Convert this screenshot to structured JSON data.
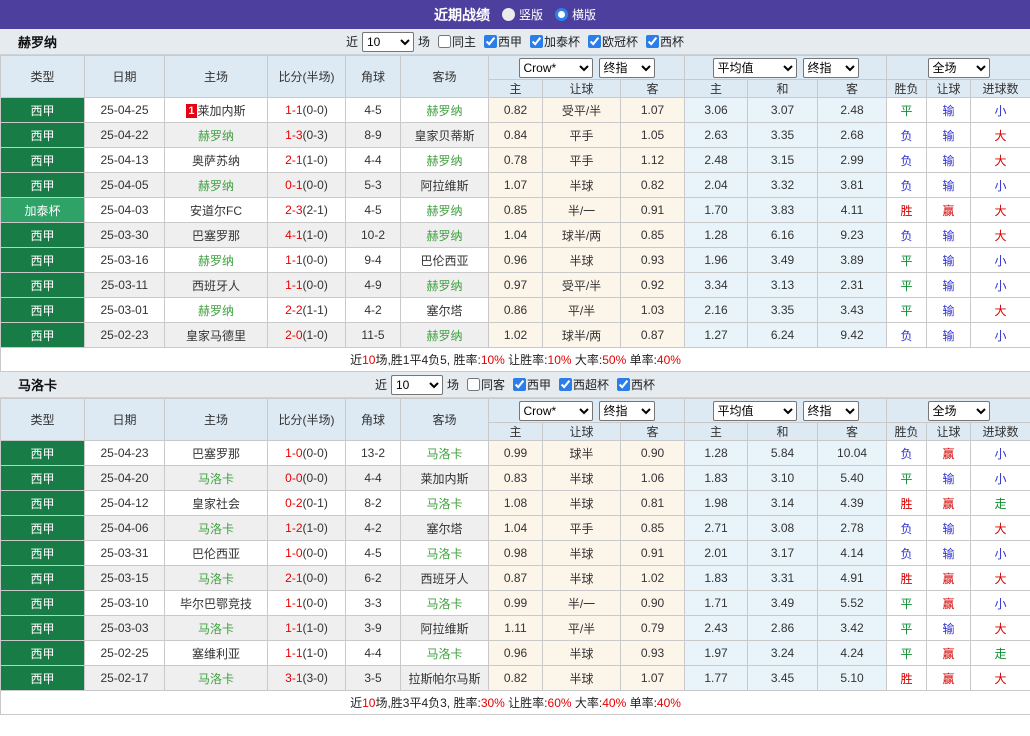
{
  "titlebar": {
    "title": "近期战绩",
    "options": [
      {
        "label": "竖版",
        "selected": true
      },
      {
        "label": "横版",
        "selected": false
      }
    ]
  },
  "columns": {
    "type": "类型",
    "date": "日期",
    "home": "主场",
    "score": "比分(半场)",
    "corner": "角球",
    "away": "客场",
    "crow": "Crow*",
    "final": "终指",
    "avg": "平均值",
    "full": "全场",
    "odds_home": "主",
    "odds_handicap": "让球",
    "odds_away": "客",
    "avg_home": "主",
    "avg_draw": "和",
    "avg_away": "客",
    "result_wdl": "胜负",
    "result_handicap": "让球",
    "result_goals": "进球数"
  },
  "accent_colors": {
    "league_green": "#187c46",
    "cup_green": "#2fa268",
    "team_green": "#3fa13f",
    "score_red": "#e60000",
    "win_red": "#d50000",
    "lose_blue": "#3030d0",
    "draw_green": "#0d8f2f",
    "titlebar_purple": "#4c3f9d"
  },
  "sections": [
    {
      "team": "赫罗纳",
      "filter": {
        "prefix": "近",
        "count": "10",
        "suffix": "场",
        "same_label": "同主",
        "same_checked": false,
        "leagues": [
          {
            "label": "西甲",
            "checked": true
          },
          {
            "label": "加泰杯",
            "checked": true
          },
          {
            "label": "欧冠杯",
            "checked": true
          },
          {
            "label": "西杯",
            "checked": true
          }
        ]
      },
      "rows": [
        {
          "type": "西甲",
          "cup": false,
          "date": "25-04-25",
          "home": "莱加内斯",
          "home_badge": "1",
          "home_green": false,
          "score": "1-1",
          "half": "(0-0)",
          "corner": "4-5",
          "away": "赫罗纳",
          "away_green": true,
          "odds": [
            "0.82",
            "受平/半",
            "1.07"
          ],
          "avg": [
            "3.06",
            "3.07",
            "2.48"
          ],
          "results": [
            "平",
            "输",
            "小"
          ]
        },
        {
          "type": "西甲",
          "cup": false,
          "date": "25-04-22",
          "home": "赫罗纳",
          "home_green": true,
          "score": "1-3",
          "half": "(0-3)",
          "corner": "8-9",
          "away": "皇家贝蒂斯",
          "away_green": false,
          "odds": [
            "0.84",
            "平手",
            "1.05"
          ],
          "avg": [
            "2.63",
            "3.35",
            "2.68"
          ],
          "results": [
            "负",
            "输",
            "大"
          ]
        },
        {
          "type": "西甲",
          "cup": false,
          "date": "25-04-13",
          "home": "奥萨苏纳",
          "home_green": false,
          "score": "2-1",
          "half": "(1-0)",
          "corner": "4-4",
          "away": "赫罗纳",
          "away_green": true,
          "odds": [
            "0.78",
            "平手",
            "1.12"
          ],
          "avg": [
            "2.48",
            "3.15",
            "2.99"
          ],
          "results": [
            "负",
            "输",
            "大"
          ]
        },
        {
          "type": "西甲",
          "cup": false,
          "date": "25-04-05",
          "home": "赫罗纳",
          "home_green": true,
          "score": "0-1",
          "half": "(0-0)",
          "corner": "5-3",
          "away": "阿拉维斯",
          "away_green": false,
          "odds": [
            "1.07",
            "半球",
            "0.82"
          ],
          "avg": [
            "2.04",
            "3.32",
            "3.81"
          ],
          "results": [
            "负",
            "输",
            "小"
          ]
        },
        {
          "type": "加泰杯",
          "cup": true,
          "date": "25-04-03",
          "home": "安道尔FC",
          "home_green": false,
          "score": "2-3",
          "half": "(2-1)",
          "corner": "4-5",
          "away": "赫罗纳",
          "away_green": true,
          "odds": [
            "0.85",
            "半/一",
            "0.91"
          ],
          "avg": [
            "1.70",
            "3.83",
            "4.11"
          ],
          "results": [
            "胜",
            "赢",
            "大"
          ]
        },
        {
          "type": "西甲",
          "cup": false,
          "date": "25-03-30",
          "home": "巴塞罗那",
          "home_green": false,
          "score": "4-1",
          "half": "(1-0)",
          "corner": "10-2",
          "away": "赫罗纳",
          "away_green": true,
          "odds": [
            "1.04",
            "球半/两",
            "0.85"
          ],
          "avg": [
            "1.28",
            "6.16",
            "9.23"
          ],
          "results": [
            "负",
            "输",
            "大"
          ]
        },
        {
          "type": "西甲",
          "cup": false,
          "date": "25-03-16",
          "home": "赫罗纳",
          "home_green": true,
          "score": "1-1",
          "half": "(0-0)",
          "corner": "9-4",
          "away": "巴伦西亚",
          "away_green": false,
          "odds": [
            "0.96",
            "半球",
            "0.93"
          ],
          "avg": [
            "1.96",
            "3.49",
            "3.89"
          ],
          "results": [
            "平",
            "输",
            "小"
          ]
        },
        {
          "type": "西甲",
          "cup": false,
          "date": "25-03-11",
          "home": "西班牙人",
          "home_green": false,
          "score": "1-1",
          "half": "(0-0)",
          "corner": "4-9",
          "away": "赫罗纳",
          "away_green": true,
          "odds": [
            "0.97",
            "受平/半",
            "0.92"
          ],
          "avg": [
            "3.34",
            "3.13",
            "2.31"
          ],
          "results": [
            "平",
            "输",
            "小"
          ]
        },
        {
          "type": "西甲",
          "cup": false,
          "date": "25-03-01",
          "home": "赫罗纳",
          "home_green": true,
          "score": "2-2",
          "half": "(1-1)",
          "corner": "4-2",
          "away": "塞尔塔",
          "away_green": false,
          "odds": [
            "0.86",
            "平/半",
            "1.03"
          ],
          "avg": [
            "2.16",
            "3.35",
            "3.43"
          ],
          "results": [
            "平",
            "输",
            "大"
          ]
        },
        {
          "type": "西甲",
          "cup": false,
          "date": "25-02-23",
          "home": "皇家马德里",
          "home_green": false,
          "score": "2-0",
          "half": "(1-0)",
          "corner": "11-5",
          "away": "赫罗纳",
          "away_green": true,
          "odds": [
            "1.02",
            "球半/两",
            "0.87"
          ],
          "avg": [
            "1.27",
            "6.24",
            "9.42"
          ],
          "results": [
            "负",
            "输",
            "小"
          ]
        }
      ],
      "summary": [
        {
          "t": "近"
        },
        {
          "t": "10",
          "red": true
        },
        {
          "t": "场,胜1平4负5, 胜率:"
        },
        {
          "t": "10%",
          "red": true
        },
        {
          "t": " 让胜率:"
        },
        {
          "t": "10%",
          "red": true
        },
        {
          "t": " 大率:"
        },
        {
          "t": "50%",
          "red": true
        },
        {
          "t": " 单率:"
        },
        {
          "t": "40%",
          "red": true
        }
      ]
    },
    {
      "team": "马洛卡",
      "filter": {
        "prefix": "近",
        "count": "10",
        "suffix": "场",
        "same_label": "同客",
        "same_checked": false,
        "leagues": [
          {
            "label": "西甲",
            "checked": true
          },
          {
            "label": "西超杯",
            "checked": true
          },
          {
            "label": "西杯",
            "checked": true
          }
        ]
      },
      "rows": [
        {
          "type": "西甲",
          "cup": false,
          "date": "25-04-23",
          "home": "巴塞罗那",
          "home_green": false,
          "score": "1-0",
          "half": "(0-0)",
          "corner": "13-2",
          "away": "马洛卡",
          "away_green": true,
          "odds": [
            "0.99",
            "球半",
            "0.90"
          ],
          "avg": [
            "1.28",
            "5.84",
            "10.04"
          ],
          "results": [
            "负",
            "赢",
            "小"
          ]
        },
        {
          "type": "西甲",
          "cup": false,
          "date": "25-04-20",
          "home": "马洛卡",
          "home_green": true,
          "score": "0-0",
          "half": "(0-0)",
          "corner": "4-4",
          "away": "莱加内斯",
          "away_green": false,
          "odds": [
            "0.83",
            "半球",
            "1.06"
          ],
          "avg": [
            "1.83",
            "3.10",
            "5.40"
          ],
          "results": [
            "平",
            "输",
            "小"
          ]
        },
        {
          "type": "西甲",
          "cup": false,
          "date": "25-04-12",
          "home": "皇家社会",
          "home_green": false,
          "score": "0-2",
          "half": "(0-1)",
          "corner": "8-2",
          "away": "马洛卡",
          "away_green": true,
          "odds": [
            "1.08",
            "半球",
            "0.81"
          ],
          "avg": [
            "1.98",
            "3.14",
            "4.39"
          ],
          "results": [
            "胜",
            "赢",
            "走"
          ]
        },
        {
          "type": "西甲",
          "cup": false,
          "date": "25-04-06",
          "home": "马洛卡",
          "home_green": true,
          "score": "1-2",
          "half": "(1-0)",
          "corner": "4-2",
          "away": "塞尔塔",
          "away_green": false,
          "odds": [
            "1.04",
            "平手",
            "0.85"
          ],
          "avg": [
            "2.71",
            "3.08",
            "2.78"
          ],
          "results": [
            "负",
            "输",
            "大"
          ]
        },
        {
          "type": "西甲",
          "cup": false,
          "date": "25-03-31",
          "home": "巴伦西亚",
          "home_green": false,
          "score": "1-0",
          "half": "(0-0)",
          "corner": "4-5",
          "away": "马洛卡",
          "away_green": true,
          "odds": [
            "0.98",
            "半球",
            "0.91"
          ],
          "avg": [
            "2.01",
            "3.17",
            "4.14"
          ],
          "results": [
            "负",
            "输",
            "小"
          ]
        },
        {
          "type": "西甲",
          "cup": false,
          "date": "25-03-15",
          "home": "马洛卡",
          "home_green": true,
          "score": "2-1",
          "half": "(0-0)",
          "corner": "6-2",
          "away": "西班牙人",
          "away_green": false,
          "odds": [
            "0.87",
            "半球",
            "1.02"
          ],
          "avg": [
            "1.83",
            "3.31",
            "4.91"
          ],
          "results": [
            "胜",
            "赢",
            "大"
          ]
        },
        {
          "type": "西甲",
          "cup": false,
          "date": "25-03-10",
          "home": "毕尔巴鄂竞技",
          "home_green": false,
          "score": "1-1",
          "half": "(0-0)",
          "corner": "3-3",
          "away": "马洛卡",
          "away_green": true,
          "odds": [
            "0.99",
            "半/一",
            "0.90"
          ],
          "avg": [
            "1.71",
            "3.49",
            "5.52"
          ],
          "results": [
            "平",
            "赢",
            "小"
          ]
        },
        {
          "type": "西甲",
          "cup": false,
          "date": "25-03-03",
          "home": "马洛卡",
          "home_green": true,
          "score": "1-1",
          "half": "(1-0)",
          "corner": "3-9",
          "away": "阿拉维斯",
          "away_green": false,
          "odds": [
            "1.11",
            "平/半",
            "0.79"
          ],
          "avg": [
            "2.43",
            "2.86",
            "3.42"
          ],
          "results": [
            "平",
            "输",
            "大"
          ]
        },
        {
          "type": "西甲",
          "cup": false,
          "date": "25-02-25",
          "home": "塞维利亚",
          "home_green": false,
          "score": "1-1",
          "half": "(1-0)",
          "corner": "4-4",
          "away": "马洛卡",
          "away_green": true,
          "odds": [
            "0.96",
            "半球",
            "0.93"
          ],
          "avg": [
            "1.97",
            "3.24",
            "4.24"
          ],
          "results": [
            "平",
            "赢",
            "走"
          ]
        },
        {
          "type": "西甲",
          "cup": false,
          "date": "25-02-17",
          "home": "马洛卡",
          "home_green": true,
          "score": "3-1",
          "half": "(3-0)",
          "corner": "3-5",
          "away": "拉斯帕尔马斯",
          "away_green": false,
          "odds": [
            "0.82",
            "半球",
            "1.07"
          ],
          "avg": [
            "1.77",
            "3.45",
            "5.10"
          ],
          "results": [
            "胜",
            "赢",
            "大"
          ]
        }
      ],
      "summary": [
        {
          "t": "近"
        },
        {
          "t": "10",
          "red": true
        },
        {
          "t": "场,胜3平4负3, 胜率:"
        },
        {
          "t": "30%",
          "red": true
        },
        {
          "t": " 让胜率:"
        },
        {
          "t": "60%",
          "red": true
        },
        {
          "t": " 大率:"
        },
        {
          "t": "40%",
          "red": true
        },
        {
          "t": " 单率:"
        },
        {
          "t": "40%",
          "red": true
        }
      ]
    }
  ]
}
